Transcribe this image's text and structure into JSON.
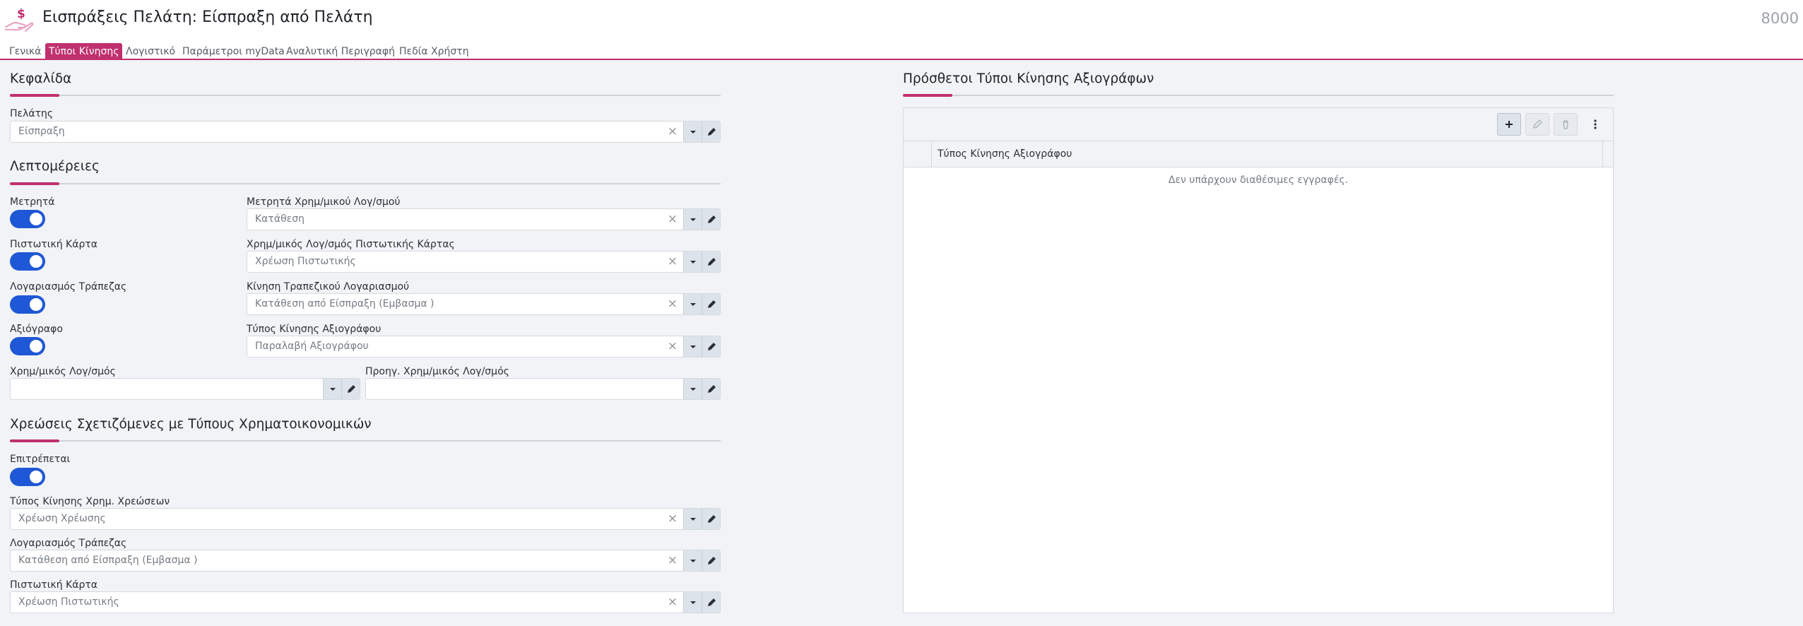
{
  "header": {
    "title": "Εισπράξεις Πελάτη: Είσπραξη από Πελάτη",
    "record_number": "8000",
    "app_icon": "hand-money-icon"
  },
  "tabs": [
    {
      "label": "Γενικά",
      "active": false
    },
    {
      "label": "Τύποι Κίνησης",
      "active": true
    },
    {
      "label": "Λογιστικό",
      "active": false
    },
    {
      "label": "Παράμετροι myData",
      "active": false
    },
    {
      "label": "Αναλυτική Περιγραφή",
      "active": false
    },
    {
      "label": "Πεδία Χρήστη",
      "active": false
    }
  ],
  "header_section": {
    "title": "Κεφαλίδα",
    "customer": {
      "label": "Πελάτης",
      "value": "Είσπραξη"
    }
  },
  "details": {
    "title": "Λεπτομέρειες",
    "cash": {
      "label": "Μετρητά",
      "enabled": true
    },
    "cash_account": {
      "label": "Μετρητά Χρημ/μικού Λογ/σμού",
      "value": "Κατάθεση"
    },
    "credit_card": {
      "label": "Πιστωτική Κάρτα",
      "enabled": true
    },
    "credit_card_account": {
      "label": "Χρημ/μικός Λογ/σμός Πιστωτικής Κάρτας",
      "value": "Χρέωση Πιστωτικής"
    },
    "bank_account": {
      "label": "Λογαριασμός Τράπεζας",
      "enabled": true
    },
    "bank_movement": {
      "label": "Κίνηση Τραπεζικού Λογαριασμού",
      "value": "Κατάθεση από Είσπραξη (Εμβασμα )"
    },
    "cheque": {
      "label": "Αξιόγραφο",
      "enabled": true
    },
    "cheque_movement_type": {
      "label": "Τύπος Κίνησης Αξιογράφου",
      "value": "Παραλαβή Αξιογράφου"
    },
    "financial_account": {
      "label": "Χρημ/μικός Λογ/σμός",
      "value": ""
    },
    "prev_financial_account": {
      "label": "Προηγ. Χρημ/μικός Λογ/σμός",
      "value": ""
    }
  },
  "charges": {
    "title": "Χρεώσεις Σχετιζόμενες με Τύπους Χρηματοικονομικών",
    "allowed": {
      "label": "Επιτρέπεται",
      "enabled": true
    },
    "charge_movement_type": {
      "label": "Τύπος Κίνησης Χρημ. Χρεώσεων",
      "value": "Χρέωση Χρέωσης"
    },
    "bank_account": {
      "label": "Λογαριασμός Τράπεζας",
      "value": "Κατάθεση από Είσπραξη (Εμβασμα )"
    },
    "credit_card": {
      "label": "Πιστωτική Κάρτα",
      "value": "Χρέωση Πιστωτικής"
    }
  },
  "additional_types": {
    "title": "Πρόσθετοι Τύποι Κίνησης Αξιογράφων",
    "column_header": "Τύπος Κίνησης Αξιογράφου",
    "empty_message": "Δεν υπάρχουν διαθέσιμες εγγραφές.",
    "toolbar": [
      "plus-icon",
      "pencil-icon",
      "trash-icon",
      "more-vertical-icon"
    ]
  },
  "colors": {
    "accent": "#c0306e",
    "toggle_on": "#1f58d6"
  }
}
